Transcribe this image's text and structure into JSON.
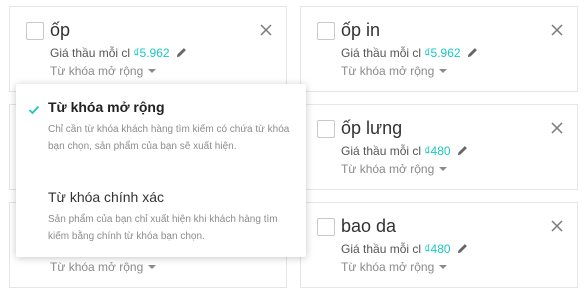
{
  "colors": {
    "price": "#1ac6c2",
    "check": "#1ac6c2"
  },
  "cards": [
    {
      "keyword": "ốp",
      "bid_label": "Giá thầu mỗi cl",
      "bid_value": "₫5.962",
      "match_type": "Từ khóa mở rộng"
    },
    {
      "keyword": "ốp in",
      "bid_label": "Giá thầu mỗi cl",
      "bid_value": "₫5.962",
      "match_type": "Từ khóa mở rộng"
    },
    {
      "keyword": "",
      "bid_label": "",
      "bid_value": "",
      "match_type": ""
    },
    {
      "keyword": "ốp lưng",
      "bid_label": "Giá thầu mỗi cl",
      "bid_value": "₫480",
      "match_type": "Từ khóa mở rộng"
    },
    {
      "keyword": "",
      "bid_label": "",
      "bid_value": "",
      "match_type": "Từ khóa mở rộng"
    },
    {
      "keyword": "bao da",
      "bid_label": "Giá thầu mỗi cl",
      "bid_value": "₫480",
      "match_type": "Từ khóa mở rộng"
    }
  ],
  "match_dropdown": {
    "options": [
      {
        "title": "Từ khóa mở rộng",
        "description": "Chỉ cần từ khóa khách hàng tìm kiếm có chứa từ khóa bạn chọn, sản phẩm của bạn sẽ xuất hiện.",
        "selected": true
      },
      {
        "title": "Từ khóa chính xác",
        "description": "Sản phẩm của bạn chỉ xuất hiện khi khách hàng tìm kiếm bằng chính từ khóa bạn chọn.",
        "selected": false
      }
    ]
  }
}
